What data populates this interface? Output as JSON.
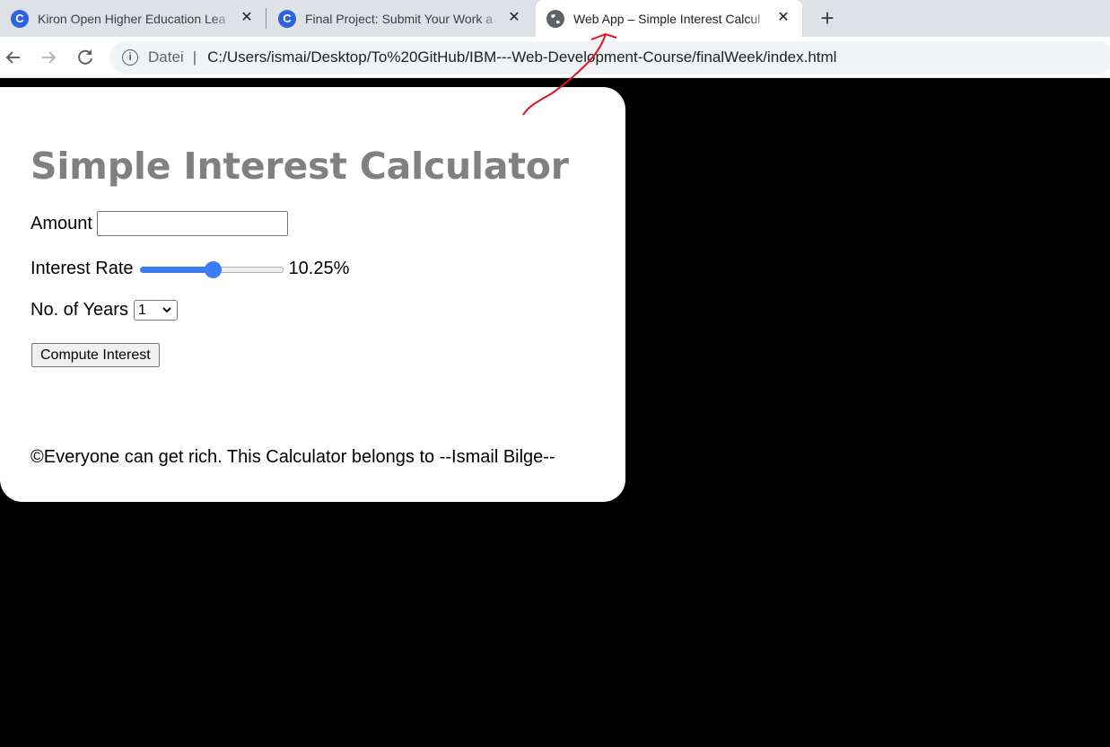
{
  "browser": {
    "tabs": [
      {
        "title": "Kiron Open Higher Education Lea",
        "icon": "kiron-c-icon",
        "active": false
      },
      {
        "title": "Final Project: Submit Your Work a",
        "icon": "kiron-c-icon",
        "active": false
      },
      {
        "title": "Web App – Simple Interest Calcul",
        "icon": "globe-icon",
        "active": true
      }
    ],
    "new_tab_label": "+",
    "address": {
      "scheme_label": "Datei",
      "url": "C:/Users/ismai/Desktop/To%20GitHub/IBM---Web-Development-Course/finalWeek/index.html"
    }
  },
  "page": {
    "heading": "Simple Interest Calculator",
    "amount": {
      "label": "Amount",
      "value": ""
    },
    "rate": {
      "label": "Interest Rate",
      "value_text": "10.25%",
      "fraction": 0.51
    },
    "years": {
      "label": "No. of Years",
      "selected": "1"
    },
    "compute_button": "Compute Interest",
    "footer": "©Everyone can get rich. This Calculator belongs to --Ismail Bilge--"
  },
  "colors": {
    "accent": "#3b7cf2",
    "heading": "#808080",
    "annotation": "#e0141e"
  }
}
